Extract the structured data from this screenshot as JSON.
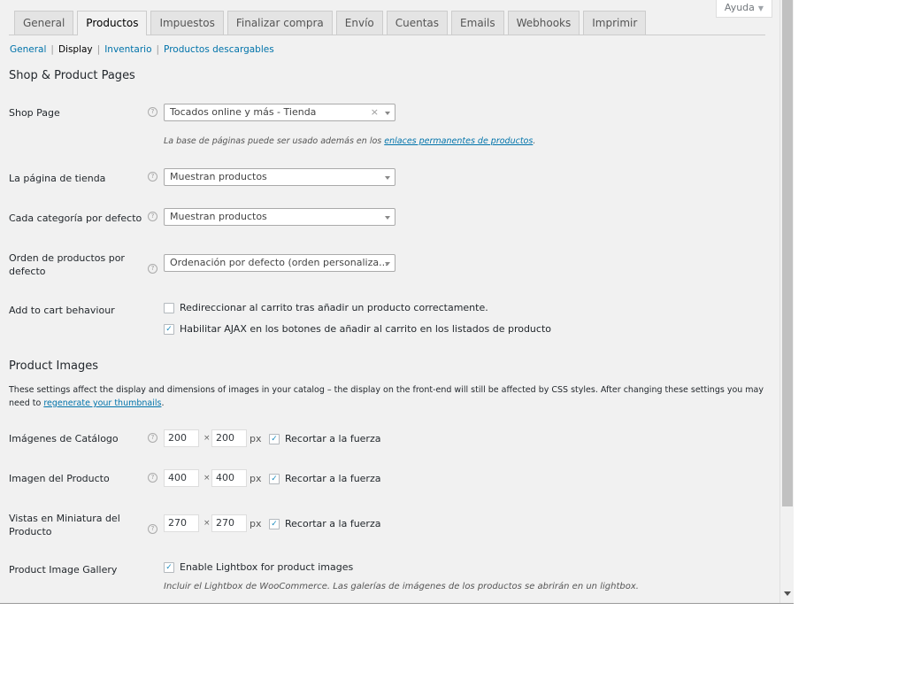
{
  "help": {
    "label": "Ayuda"
  },
  "tabs": [
    {
      "label": "General",
      "active": false
    },
    {
      "label": "Productos",
      "active": true
    },
    {
      "label": "Impuestos",
      "active": false
    },
    {
      "label": "Finalizar compra",
      "active": false
    },
    {
      "label": "Envío",
      "active": false
    },
    {
      "label": "Cuentas",
      "active": false
    },
    {
      "label": "Emails",
      "active": false
    },
    {
      "label": "Webhooks",
      "active": false
    },
    {
      "label": "Imprimir",
      "active": false
    }
  ],
  "subnav": {
    "general": "General",
    "display": "Display",
    "inventario": "Inventario",
    "descargables": "Productos descargables",
    "separator": "|"
  },
  "shop_section": {
    "title": "Shop & Product Pages",
    "shop_page": {
      "label": "Shop Page",
      "value": "Tocados online y más - Tienda",
      "clear": "×",
      "desc_prefix": "La base de páginas puede ser usado además en los",
      "desc_link": "enlaces permanentes de productos",
      "desc_suffix": "."
    },
    "shop_display": {
      "label": "La página de tienda",
      "value": "Muestran productos"
    },
    "category_display": {
      "label": "Cada categoría por defecto",
      "value": "Muestran productos"
    },
    "default_sort": {
      "label_line1": "Orden de productos por",
      "label_line2": "defecto",
      "value": "Ordenación por defecto (orden personaliza..."
    },
    "add_to_cart": {
      "label": "Add to cart behaviour",
      "redirect": {
        "text": "Redireccionar al carrito tras añadir un producto correctamente.",
        "checked": false
      },
      "ajax": {
        "text": "Habilitar AJAX en los botones de añadir al carrito en los listados de producto",
        "checked": true
      }
    }
  },
  "images_section": {
    "title": "Product Images",
    "note_part1": "These settings affect the display and dimensions of images in your catalog – the display on the front-end will still be affected by CSS styles. After changing these settings you may",
    "note_part2": "need to",
    "note_link": "regenerate your thumbnails",
    "note_end": ".",
    "times": "×",
    "px": "px",
    "crop_label": "Recortar a la fuerza",
    "catalog": {
      "label": "Imágenes de Catálogo",
      "width": "200",
      "height": "200",
      "crop": true
    },
    "single": {
      "label": "Imagen del Producto",
      "width": "400",
      "height": "400",
      "crop": true
    },
    "thumbnail": {
      "label_line1": "Vistas en Miniatura del",
      "label_line2": "Producto",
      "width": "270",
      "height": "270",
      "crop": true
    },
    "gallery": {
      "label": "Product Image Gallery",
      "lightbox": {
        "text": "Enable Lightbox for product images",
        "checked": true
      },
      "desc": "Incluir el Lightbox de WooCommerce. Las galerías de imágenes de los productos se abrirán en un lightbox."
    }
  },
  "icons": {
    "help_tip": "?",
    "check": "✓"
  }
}
